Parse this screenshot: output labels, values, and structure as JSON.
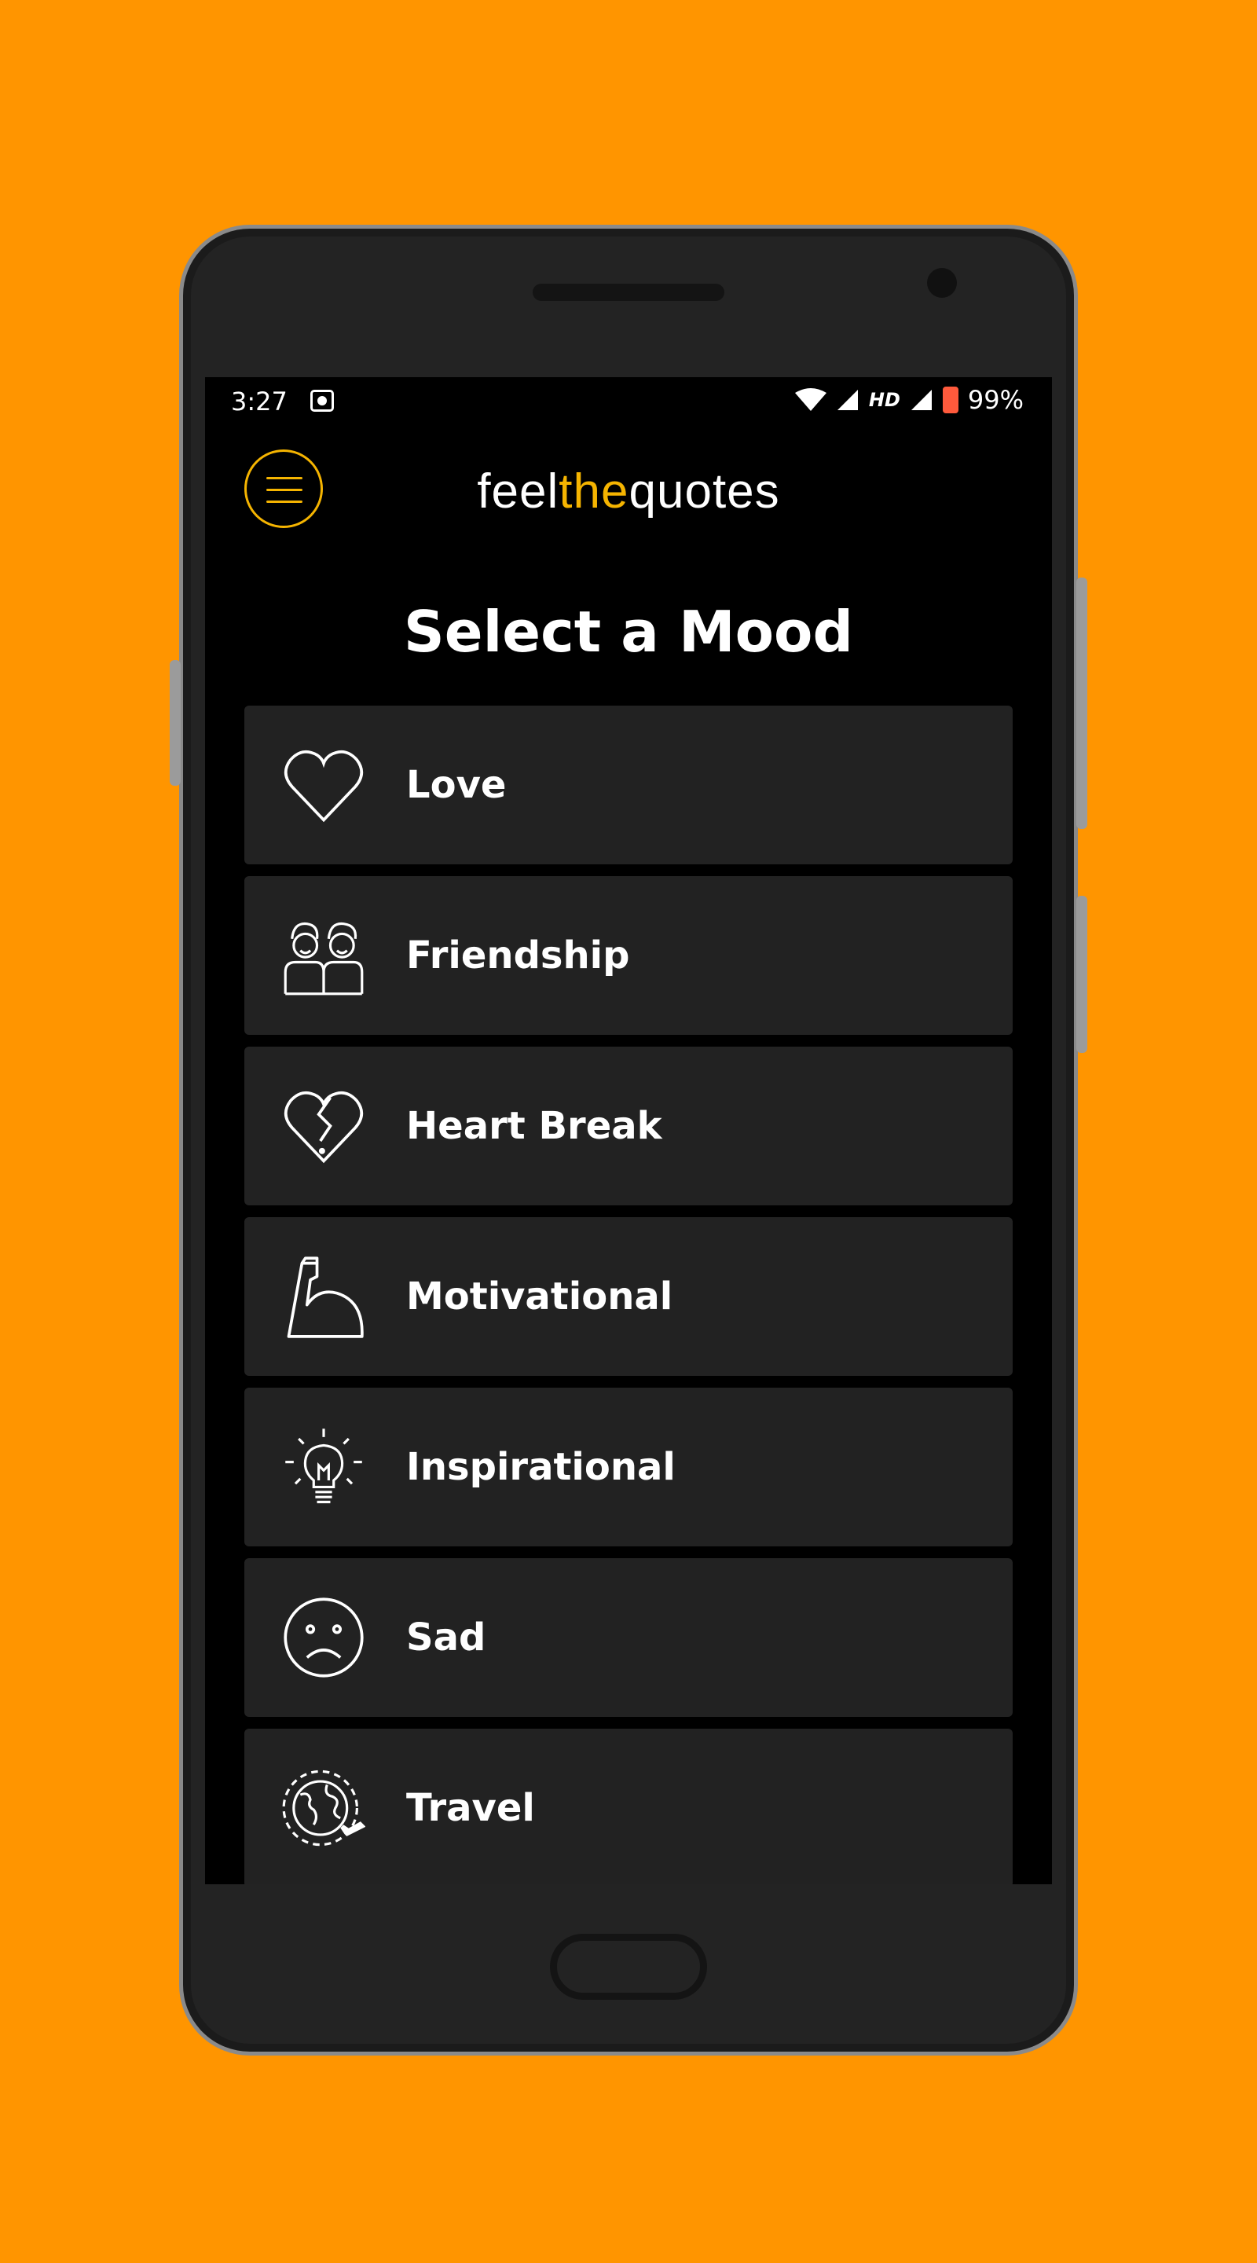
{
  "status_bar": {
    "time": "3:27",
    "network_label": "HD",
    "battery": "99%"
  },
  "app": {
    "logo_part1": "feel",
    "logo_part2": "the",
    "logo_part3": "quotes",
    "accent_color": "#F5B400"
  },
  "page_title": "Select a Mood",
  "moods": [
    {
      "label": "Love",
      "icon": "heart-icon"
    },
    {
      "label": "Friendship",
      "icon": "friends-icon"
    },
    {
      "label": "Heart Break",
      "icon": "broken-heart-icon"
    },
    {
      "label": "Motivational",
      "icon": "flexed-arm-icon"
    },
    {
      "label": "Inspirational",
      "icon": "lightbulb-icon"
    },
    {
      "label": "Sad",
      "icon": "sad-face-icon"
    },
    {
      "label": "Travel",
      "icon": "globe-plane-icon"
    }
  ]
}
